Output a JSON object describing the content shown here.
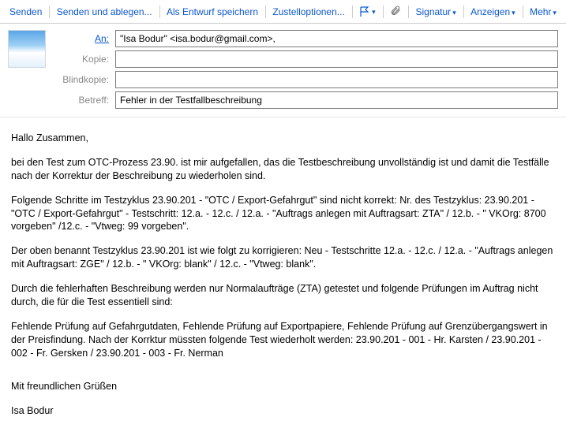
{
  "toolbar": {
    "send": "Senden",
    "send_file": "Senden und ablegen...",
    "save_draft": "Als Entwurf speichern",
    "delivery_opts": "Zustelloptionen...",
    "signature": "Signatur",
    "display": "Anzeigen",
    "more": "Mehr"
  },
  "labels": {
    "to": "An:",
    "cc": "Kopie:",
    "bcc": "Blindkopie:",
    "subject": "Betreff:"
  },
  "fields": {
    "to": "\"Isa Bodur\" <isa.bodur@gmail.com>,",
    "cc": "",
    "bcc": "",
    "subject": "Fehler in der Testfallbeschreibung"
  },
  "body": {
    "p1": "Hallo Zusammen,",
    "p2": "bei den Test zum OTC-Prozess 23.90. ist mir aufgefallen, das die Testbeschreibung unvollständig ist und damit die Testfälle nach der Korrektur der Beschreibung zu wiederholen sind.",
    "p3": "Folgende Schritte im Testzyklus 23.90.201 - \"OTC / Export-Gefahrgut\" sind nicht korrekt: Nr. des Testzyklus: 23.90.201 - \"OTC / Export-Gefahrgut\" - Testschritt: 12.a. - 12.c. / 12.a. -  \"Auftrags anlegen mit Auftragsart: ZTA\" / 12.b. - \" VKOrg: 8700 vorgeben\" /12.c. - \"Vtweg: 99 vorgeben\".",
    "p4": "Der oben benannt Testzyklus 23.90.201 ist wie folgt zu korrigieren: Neu - Testschritte 12.a. - 12.c. / 12.a. -  \"Auftrags anlegen mit Auftragsart: ZGE\" / 12.b. - \" VKOrg: blank\" / 12.c. - \"Vtweg: blank\".",
    "p5": "Durch die fehlerhaften Beschreibung werden nur Normalaufträge (ZTA) getestet und folgende Prüfungen im Auftrag nicht durch, die für die Test essentiell sind:",
    "p6": "Fehlende Prüfung auf Gefahrgutdaten, Fehlende Prüfung auf Exportpapiere, Fehlende Prüfung auf Grenzübergangswert in der Preisfindung. Nach der Korrktur müssten folgende Test wiederholt werden: 23.90.201 - 001 - Hr. Karsten / 23.90.201 - 002 - Fr. Gersken / 23.90.201 - 003 - Fr. Nerman",
    "p7": "Mit freundlichen Grüßen",
    "p8": "Isa Bodur"
  }
}
